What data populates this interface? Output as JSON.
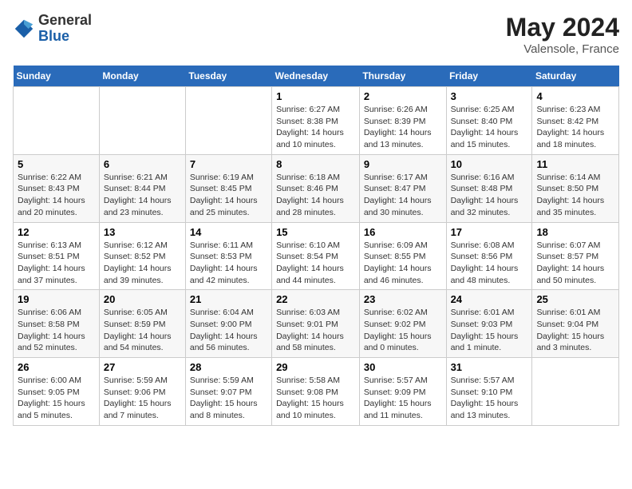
{
  "header": {
    "logo_general": "General",
    "logo_blue": "Blue",
    "month_year": "May 2024",
    "location": "Valensole, France"
  },
  "weekdays": [
    "Sunday",
    "Monday",
    "Tuesday",
    "Wednesday",
    "Thursday",
    "Friday",
    "Saturday"
  ],
  "weeks": [
    [
      {
        "day": "",
        "info": ""
      },
      {
        "day": "",
        "info": ""
      },
      {
        "day": "",
        "info": ""
      },
      {
        "day": "1",
        "info": "Sunrise: 6:27 AM\nSunset: 8:38 PM\nDaylight: 14 hours\nand 10 minutes."
      },
      {
        "day": "2",
        "info": "Sunrise: 6:26 AM\nSunset: 8:39 PM\nDaylight: 14 hours\nand 13 minutes."
      },
      {
        "day": "3",
        "info": "Sunrise: 6:25 AM\nSunset: 8:40 PM\nDaylight: 14 hours\nand 15 minutes."
      },
      {
        "day": "4",
        "info": "Sunrise: 6:23 AM\nSunset: 8:42 PM\nDaylight: 14 hours\nand 18 minutes."
      }
    ],
    [
      {
        "day": "5",
        "info": "Sunrise: 6:22 AM\nSunset: 8:43 PM\nDaylight: 14 hours\nand 20 minutes."
      },
      {
        "day": "6",
        "info": "Sunrise: 6:21 AM\nSunset: 8:44 PM\nDaylight: 14 hours\nand 23 minutes."
      },
      {
        "day": "7",
        "info": "Sunrise: 6:19 AM\nSunset: 8:45 PM\nDaylight: 14 hours\nand 25 minutes."
      },
      {
        "day": "8",
        "info": "Sunrise: 6:18 AM\nSunset: 8:46 PM\nDaylight: 14 hours\nand 28 minutes."
      },
      {
        "day": "9",
        "info": "Sunrise: 6:17 AM\nSunset: 8:47 PM\nDaylight: 14 hours\nand 30 minutes."
      },
      {
        "day": "10",
        "info": "Sunrise: 6:16 AM\nSunset: 8:48 PM\nDaylight: 14 hours\nand 32 minutes."
      },
      {
        "day": "11",
        "info": "Sunrise: 6:14 AM\nSunset: 8:50 PM\nDaylight: 14 hours\nand 35 minutes."
      }
    ],
    [
      {
        "day": "12",
        "info": "Sunrise: 6:13 AM\nSunset: 8:51 PM\nDaylight: 14 hours\nand 37 minutes."
      },
      {
        "day": "13",
        "info": "Sunrise: 6:12 AM\nSunset: 8:52 PM\nDaylight: 14 hours\nand 39 minutes."
      },
      {
        "day": "14",
        "info": "Sunrise: 6:11 AM\nSunset: 8:53 PM\nDaylight: 14 hours\nand 42 minutes."
      },
      {
        "day": "15",
        "info": "Sunrise: 6:10 AM\nSunset: 8:54 PM\nDaylight: 14 hours\nand 44 minutes."
      },
      {
        "day": "16",
        "info": "Sunrise: 6:09 AM\nSunset: 8:55 PM\nDaylight: 14 hours\nand 46 minutes."
      },
      {
        "day": "17",
        "info": "Sunrise: 6:08 AM\nSunset: 8:56 PM\nDaylight: 14 hours\nand 48 minutes."
      },
      {
        "day": "18",
        "info": "Sunrise: 6:07 AM\nSunset: 8:57 PM\nDaylight: 14 hours\nand 50 minutes."
      }
    ],
    [
      {
        "day": "19",
        "info": "Sunrise: 6:06 AM\nSunset: 8:58 PM\nDaylight: 14 hours\nand 52 minutes."
      },
      {
        "day": "20",
        "info": "Sunrise: 6:05 AM\nSunset: 8:59 PM\nDaylight: 14 hours\nand 54 minutes."
      },
      {
        "day": "21",
        "info": "Sunrise: 6:04 AM\nSunset: 9:00 PM\nDaylight: 14 hours\nand 56 minutes."
      },
      {
        "day": "22",
        "info": "Sunrise: 6:03 AM\nSunset: 9:01 PM\nDaylight: 14 hours\nand 58 minutes."
      },
      {
        "day": "23",
        "info": "Sunrise: 6:02 AM\nSunset: 9:02 PM\nDaylight: 15 hours\nand 0 minutes."
      },
      {
        "day": "24",
        "info": "Sunrise: 6:01 AM\nSunset: 9:03 PM\nDaylight: 15 hours\nand 1 minute."
      },
      {
        "day": "25",
        "info": "Sunrise: 6:01 AM\nSunset: 9:04 PM\nDaylight: 15 hours\nand 3 minutes."
      }
    ],
    [
      {
        "day": "26",
        "info": "Sunrise: 6:00 AM\nSunset: 9:05 PM\nDaylight: 15 hours\nand 5 minutes."
      },
      {
        "day": "27",
        "info": "Sunrise: 5:59 AM\nSunset: 9:06 PM\nDaylight: 15 hours\nand 7 minutes."
      },
      {
        "day": "28",
        "info": "Sunrise: 5:59 AM\nSunset: 9:07 PM\nDaylight: 15 hours\nand 8 minutes."
      },
      {
        "day": "29",
        "info": "Sunrise: 5:58 AM\nSunset: 9:08 PM\nDaylight: 15 hours\nand 10 minutes."
      },
      {
        "day": "30",
        "info": "Sunrise: 5:57 AM\nSunset: 9:09 PM\nDaylight: 15 hours\nand 11 minutes."
      },
      {
        "day": "31",
        "info": "Sunrise: 5:57 AM\nSunset: 9:10 PM\nDaylight: 15 hours\nand 13 minutes."
      },
      {
        "day": "",
        "info": ""
      }
    ]
  ]
}
